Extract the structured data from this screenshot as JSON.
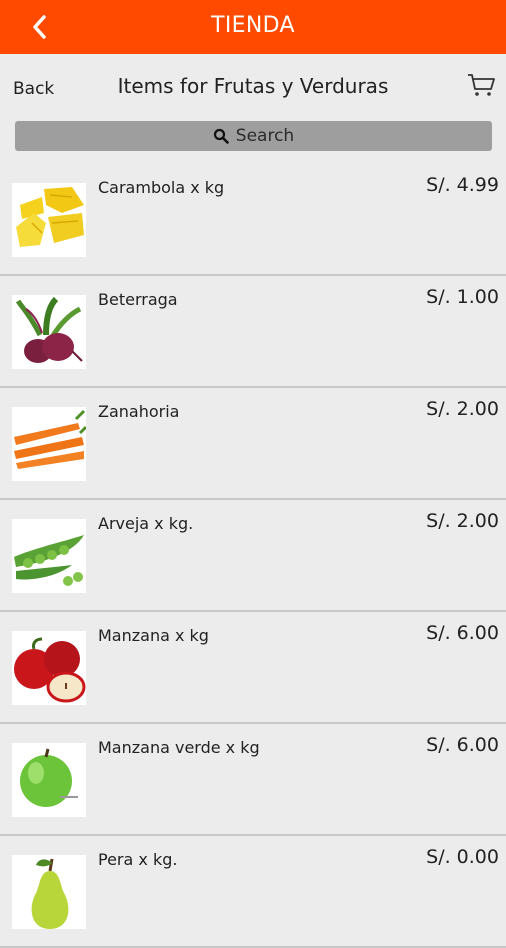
{
  "app": {
    "title": "TIENDA"
  },
  "subheader": {
    "back_label": "Back",
    "title": "Items for Frutas y Verduras"
  },
  "search": {
    "label": "Search"
  },
  "colors": {
    "brand": "#ff4a00",
    "background": "#ececec",
    "search_bg": "#9e9e9e"
  },
  "products": [
    {
      "name": "Carambola x kg",
      "price": "S/. 4.99",
      "image": "carambola-image"
    },
    {
      "name": "Beterraga",
      "price": "S/. 1.00",
      "image": "beet-image"
    },
    {
      "name": "Zanahoria",
      "price": "S/. 2.00",
      "image": "carrot-image"
    },
    {
      "name": "Arveja x kg.",
      "price": "S/. 2.00",
      "image": "peas-image"
    },
    {
      "name": "Manzana x kg",
      "price": "S/. 6.00",
      "image": "red-apple-image"
    },
    {
      "name": "Manzana verde x kg",
      "price": "S/. 6.00",
      "image": "green-apple-image"
    },
    {
      "name": "Pera x kg.",
      "price": "S/. 0.00",
      "image": "pear-image"
    }
  ]
}
